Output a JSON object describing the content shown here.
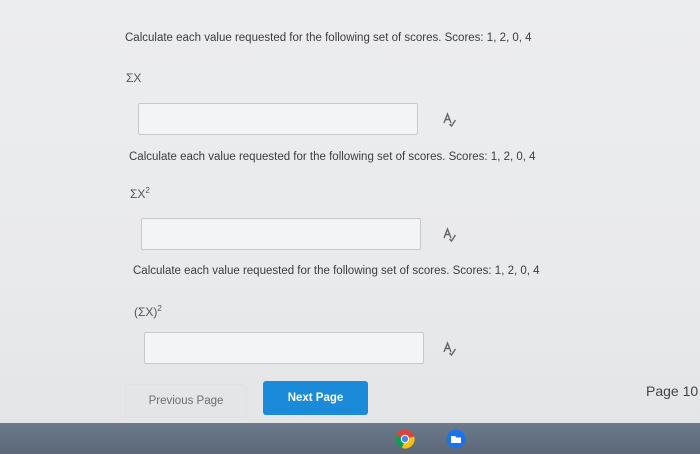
{
  "questions": [
    {
      "prompt": "Calculate each value requested for the following set of scores. Scores: 1, 2, 0, 4",
      "expression": "ΣX",
      "sup": "",
      "answer": ""
    },
    {
      "prompt": "Calculate each value requested for the following set of scores. Scores: 1, 2, 0, 4",
      "expression": "ΣX",
      "sup": "2",
      "answer": ""
    },
    {
      "prompt": "Calculate each value requested for the following set of scores. Scores: 1, 2, 0, 4",
      "expression": "(ΣX)",
      "sup": "2",
      "answer": ""
    }
  ],
  "nav": {
    "previous_label": "Previous Page",
    "next_label": "Next Page",
    "page_label": "Page 10"
  },
  "taskbar": {
    "apps": [
      "chrome-icon",
      "files-icon"
    ]
  },
  "colors": {
    "next_button": "#1b8ad8",
    "background": "#ebecee",
    "taskbar": "#647184"
  }
}
